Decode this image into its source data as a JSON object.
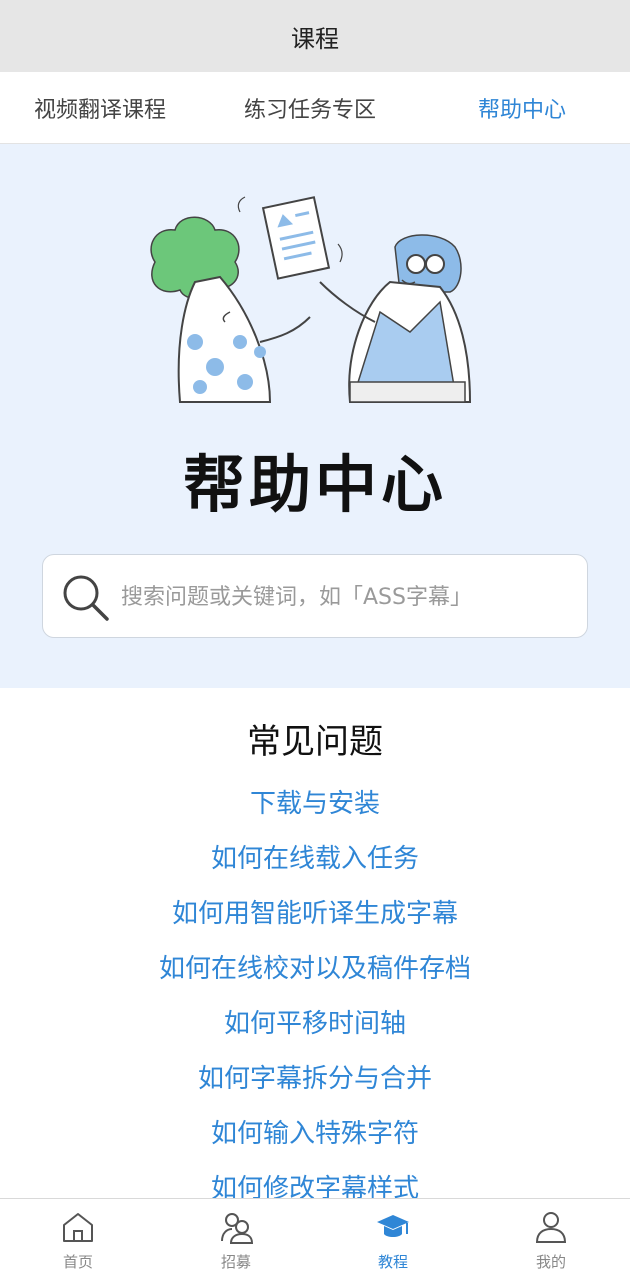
{
  "app": {
    "title": "课程"
  },
  "tabs": [
    {
      "label": "视频翻译课程",
      "active": false
    },
    {
      "label": "练习任务专区",
      "active": false
    },
    {
      "label": "帮助中心",
      "active": true
    }
  ],
  "hero": {
    "title": "帮助中心",
    "search_placeholder": "搜索问题或关键词，如「ASS字幕」"
  },
  "faq": {
    "title": "常见问题",
    "items": [
      "下载与安装",
      "如何在线载入任务",
      "如何用智能听译生成字幕",
      "如何在线校对以及稿件存档",
      "如何平移时间轴",
      "如何字幕拆分与合并",
      "如何输入特殊字符",
      "如何修改字幕样式"
    ]
  },
  "bottom_nav": [
    {
      "label": "首页",
      "icon": "home-icon",
      "active": false
    },
    {
      "label": "招募",
      "icon": "people-icon",
      "active": false
    },
    {
      "label": "教程",
      "icon": "graduation-cap-icon",
      "active": true
    },
    {
      "label": "我的",
      "icon": "user-icon",
      "active": false
    }
  ],
  "colors": {
    "accent": "#2f86d6",
    "hero_bg": "#eaf2fd",
    "titlebar_bg": "#e6e6e6"
  }
}
